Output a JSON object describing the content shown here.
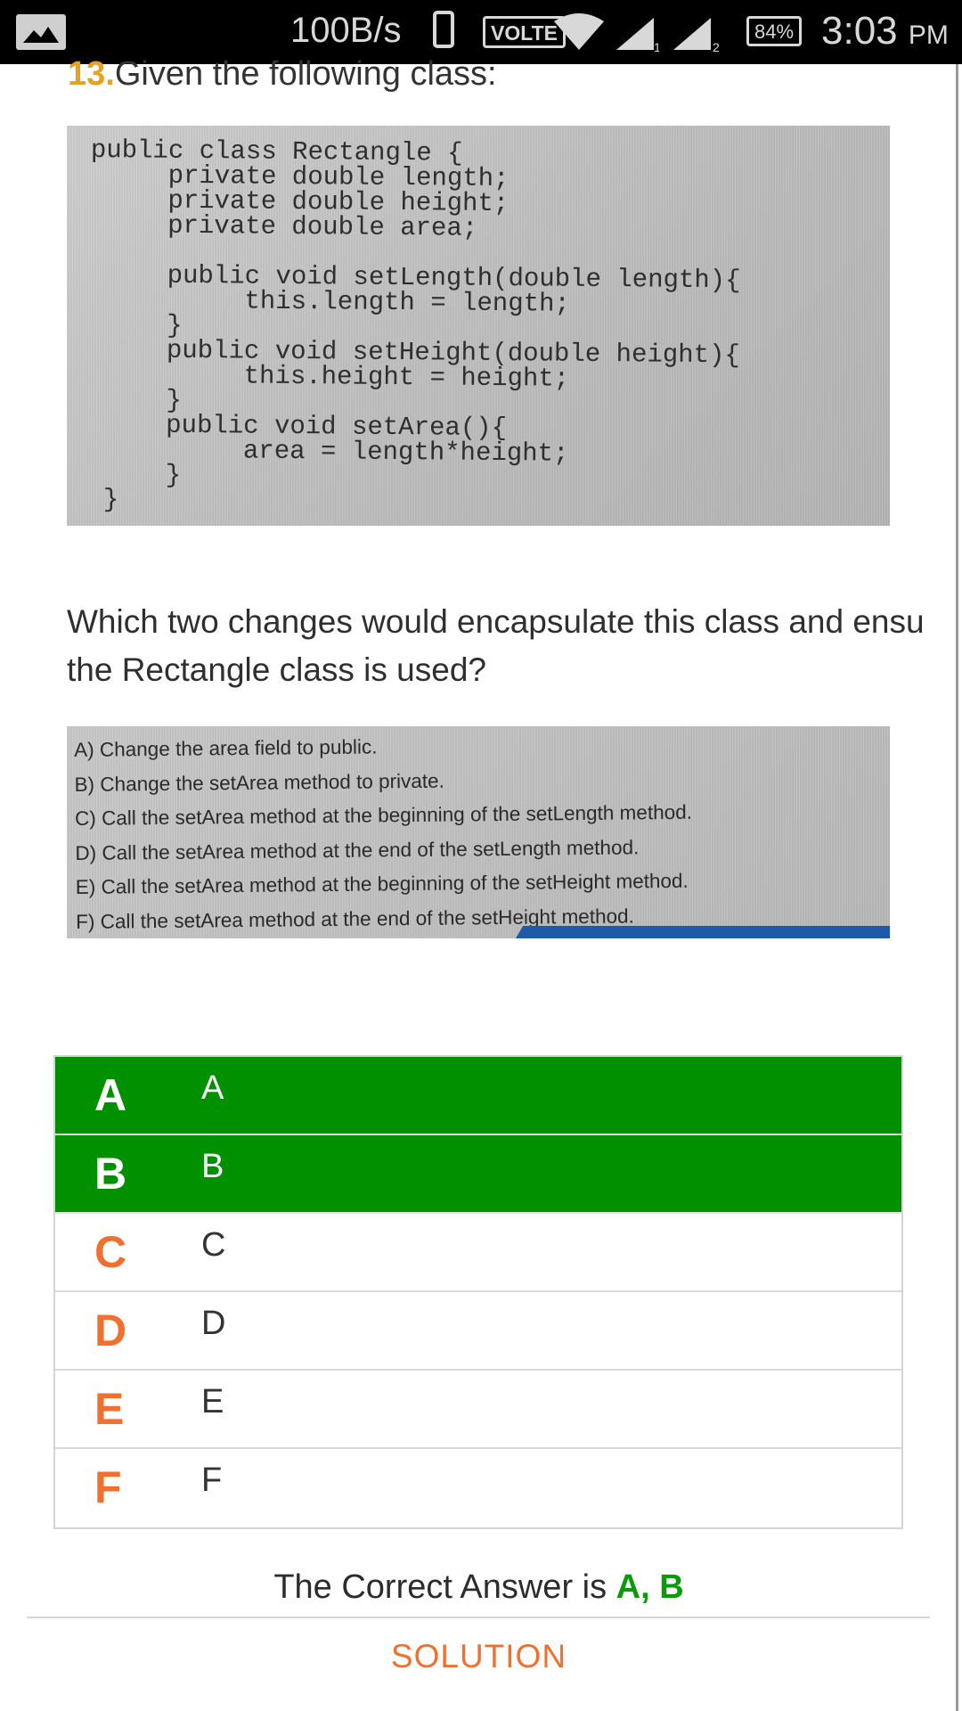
{
  "status_bar": {
    "speed": "100B/s",
    "volte": "VOLTE",
    "sim1": "1",
    "sim2": "2",
    "battery": "84%",
    "time": "3:03",
    "ampm": "PM",
    "icons": [
      "image-icon",
      "phone-icon",
      "wifi-icon",
      "signal-icon",
      "battery-icon"
    ]
  },
  "question": {
    "number": "13.",
    "title": "Given the following class:",
    "code_lines": [
      "public class Rectangle {",
      "     private double length;",
      "     private double height;",
      "     private double area;",
      "",
      "     public void setLength(double length){",
      "          this.length = length;",
      "     }",
      "     public void setHeight(double height){",
      "          this.height = height;",
      "     }",
      "     public void setArea(){",
      "          area = length*height;",
      "     }",
      " }"
    ],
    "prompt_line1": "Which two changes would encapsulate this class and ensu",
    "prompt_line2": "the Rectangle class is used?",
    "image_options": [
      "A) Change the area field to public.",
      "B) Change the setArea method to private.",
      "C) Call the setArea method at the beginning of the setLength method.",
      "D) Call the setArea method at the end of the setLength method.",
      "E) Call the setArea method at the beginning of the setHeight method.",
      "F) Call the setArea method at the end of the setHeight method."
    ]
  },
  "answers": [
    {
      "letter": "A",
      "text": "A",
      "selected": true
    },
    {
      "letter": "B",
      "text": "B",
      "selected": true
    },
    {
      "letter": "C",
      "text": "C",
      "selected": false
    },
    {
      "letter": "D",
      "text": "D",
      "selected": false
    },
    {
      "letter": "E",
      "text": "E",
      "selected": false
    },
    {
      "letter": "F",
      "text": "F",
      "selected": false
    }
  ],
  "result": {
    "prefix": "The Correct Answer is",
    "value": "A, B"
  },
  "solution_label": "SOLUTION",
  "colors": {
    "selected_bg": "#009000",
    "letter_accent": "#f07030",
    "question_number": "#e8a020",
    "correct_value": "#0a9a0a"
  }
}
